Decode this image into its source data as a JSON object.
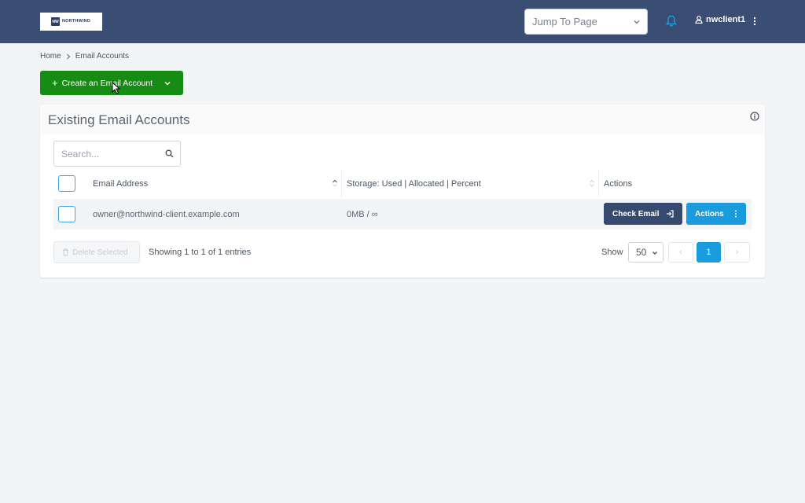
{
  "brand": {
    "logo_mark": "NW",
    "logo_text": "NORTHWIND"
  },
  "topbar": {
    "jump_placeholder": "Jump To Page",
    "notifications_icon": "bell-icon",
    "username": "nwclient1"
  },
  "breadcrumb": {
    "home": "Home",
    "current": "Email Accounts"
  },
  "create_button": {
    "label": "Create an Email Account"
  },
  "card": {
    "title": "Existing Email Accounts",
    "search_placeholder": "Search...",
    "columns": {
      "email": "Email Address",
      "storage": "Storage: Used | Allocated | Percent",
      "actions": "Actions"
    },
    "rows": [
      {
        "email": "owner@northwind-client.example.com",
        "storage": "0MB / ∞",
        "check_email": "Check Email",
        "actions": "Actions"
      }
    ],
    "delete_selected": "Delete Selected",
    "showing": "Showing 1 to 1 of 1 entries",
    "show_label": "Show",
    "per_page": "50",
    "pagination": {
      "prev": "‹",
      "current": "1",
      "next": "›"
    }
  },
  "colors": {
    "topbar": "#3a4e74",
    "create_button": "#168c14",
    "check_email_button": "#36496e",
    "actions_button": "#1a9bdd",
    "page_active": "#1a9bdd"
  }
}
